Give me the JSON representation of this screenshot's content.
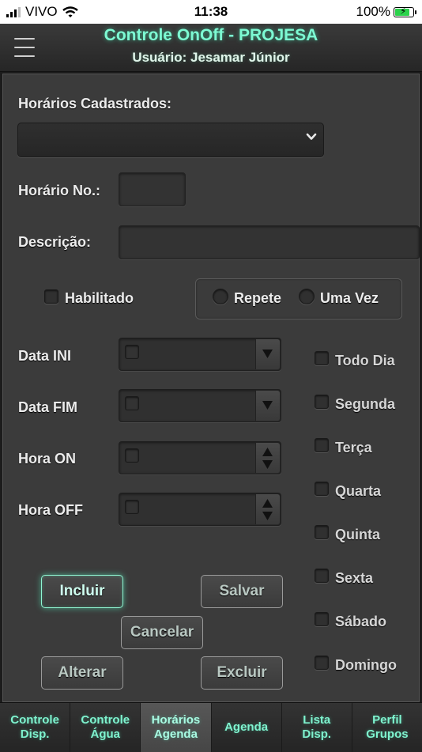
{
  "status_bar": {
    "carrier": "VIVO",
    "time": "11:38",
    "battery": "100%"
  },
  "header": {
    "title": "Controle OnOff - PROJESA",
    "subtitle": "Usuário: Jesamar Júnior"
  },
  "form": {
    "horarios_cadastrados_label": "Horários Cadastrados:",
    "horarios_cadastrados_value": "",
    "horario_no_label": "Horário No.:",
    "horario_no_value": "",
    "descricao_label": "Descrição:",
    "descricao_value": "",
    "habilitado_label": "Habilitado",
    "repete_label": "Repete",
    "uma_vez_label": "Uma Vez",
    "data_ini_label": "Data INI",
    "data_fim_label": "Data FIM",
    "hora_on_label": "Hora ON",
    "hora_off_label": "Hora OFF"
  },
  "days": [
    "Todo Dia",
    "Segunda",
    "Terça",
    "Quarta",
    "Quinta",
    "Sexta",
    "Sábado",
    "Domingo"
  ],
  "buttons": {
    "incluir": "Incluir",
    "salvar": "Salvar",
    "cancelar": "Cancelar",
    "alterar": "Alterar",
    "excluir": "Excluir"
  },
  "tabs": [
    {
      "label": "Controle\nDisp.",
      "active": false
    },
    {
      "label": "Controle\nÁgua",
      "active": false
    },
    {
      "label": "Horários\nAgenda",
      "active": true
    },
    {
      "label": "Agenda",
      "active": false
    },
    {
      "label": "Lista\nDisp.",
      "active": false
    },
    {
      "label": "Perfil\nGrupos",
      "active": false
    }
  ],
  "colors": {
    "accent": "#7dfad3",
    "panel": "#3b3b3b",
    "battery_fill": "#2bd24b"
  }
}
